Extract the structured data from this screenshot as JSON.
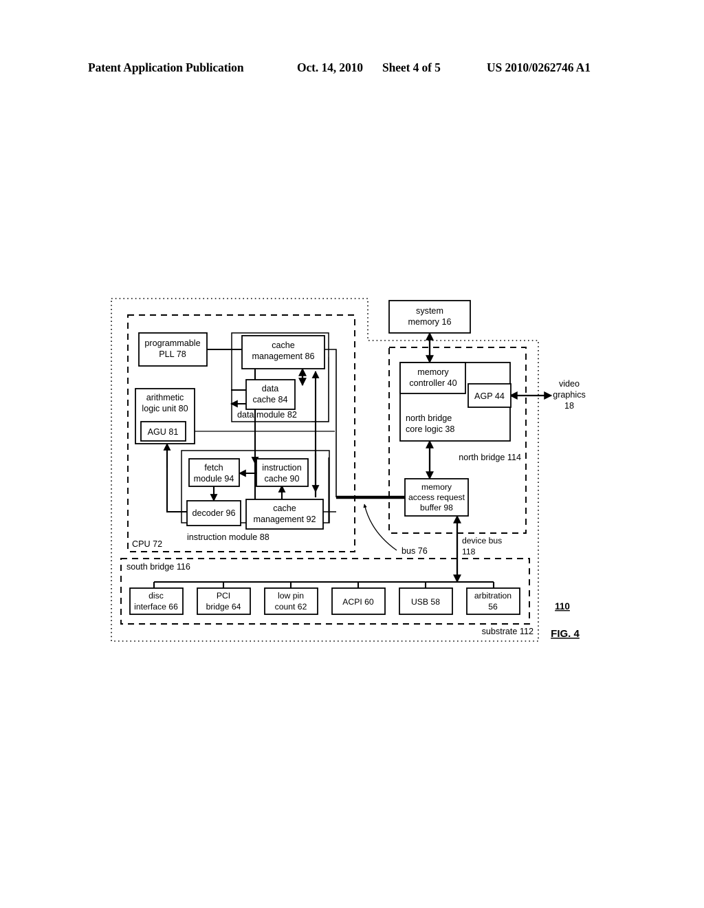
{
  "header": {
    "publication": "Patent Application Publication",
    "date": "Oct. 14, 2010",
    "sheet": "Sheet 4 of 5",
    "number": "US 2010/0262746 A1"
  },
  "figure": {
    "label": "FIG. 4",
    "reference_numeral": "110",
    "substrate_label": "substrate 112"
  },
  "blocks": {
    "programmable_pll": "programmable\nPLL 78",
    "programmable_pll_l1": "programmable",
    "programmable_pll_l2": "PLL 78",
    "alu_l1": "arithmetic",
    "alu_l2": "logic unit 80",
    "agu": "AGU 81",
    "cache_mgmt_86_l1": "cache",
    "cache_mgmt_86_l2": "management 86",
    "data_cache_l1": "data",
    "data_cache_l2": "cache 84",
    "data_module": "data module 82",
    "fetch_module_l1": "fetch",
    "fetch_module_l2": "module 94",
    "instruction_cache_l1": "instruction",
    "instruction_cache_l2": "cache 90",
    "decoder": "decoder 96",
    "cache_mgmt_92_l1": "cache",
    "cache_mgmt_92_l2": "management 92",
    "instruction_module": "instruction module 88",
    "cpu": "CPU 72",
    "system_memory_l1": "system",
    "system_memory_l2": "memory 16",
    "memory_controller_l1": "memory",
    "memory_controller_l2": "controller 40",
    "agp": "AGP 44",
    "north_bridge_core_l1": "north bridge",
    "north_bridge_core_l2": "core logic 38",
    "north_bridge": "north bridge 114",
    "memory_access_buffer_l1": "memory",
    "memory_access_buffer_l2": "access request",
    "memory_access_buffer_l3": "buffer 98",
    "video_graphics_l1": "video",
    "video_graphics_l2": "graphics",
    "video_graphics_l3": "18",
    "bus76": "bus 76",
    "device_bus_l1": "device bus",
    "device_bus_l2": "118",
    "south_bridge": "south bridge 116"
  },
  "south_bridge_devices": [
    {
      "line1": "disc",
      "line2": "interface 66"
    },
    {
      "line1": "PCI",
      "line2": "bridge 64"
    },
    {
      "line1": "low pin",
      "line2": "count 62"
    },
    {
      "line1": "ACPI 60",
      "line2": ""
    },
    {
      "line1": "USB 58",
      "line2": ""
    },
    {
      "line1": "arbitration",
      "line2": "56"
    }
  ],
  "colors": {
    "ink": "#000000",
    "paper": "#ffffff"
  }
}
